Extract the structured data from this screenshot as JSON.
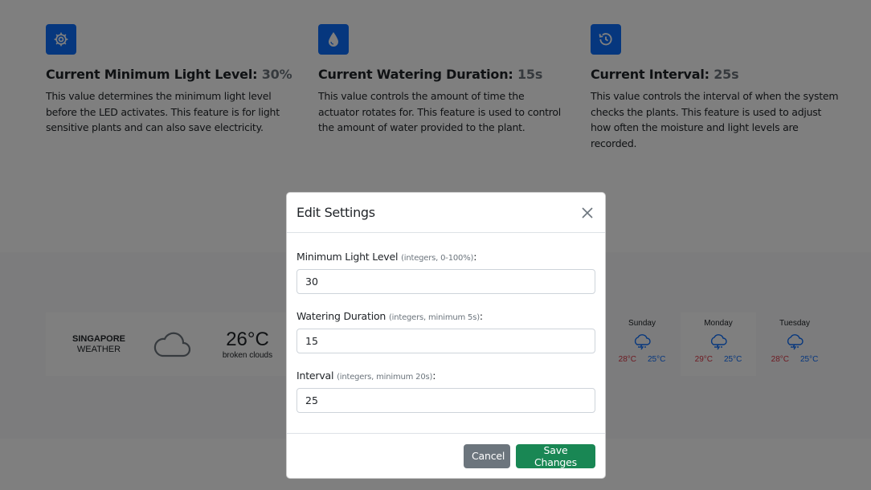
{
  "features": [
    {
      "icon": "gear-icon",
      "title": "Current Minimum Light Level:",
      "value": "30%",
      "description": "This value determines the minimum light level before the LED activates. This feature is for light sensitive plants and can also save electricity."
    },
    {
      "icon": "water-drop-icon",
      "title": "Current Watering Duration:",
      "value": "15s",
      "description": "This value controls the amount of time the actuator rotates for. This feature is used to control the amount of water provided to the plant."
    },
    {
      "icon": "history-clock-icon",
      "title": "Current Interval:",
      "value": "25s",
      "description": "This value controls the interval of when the system checks the plants. This feature is used to adjust how often the moisture and light levels are recorded."
    }
  ],
  "weather": {
    "city": "SINGAPORE",
    "city_sub": "WEATHER",
    "temp": "26°C",
    "condition": "broken clouds",
    "icon": "cloud-icon",
    "forecast": [
      {
        "day": "Sunday",
        "high": "28°C",
        "low": "25°C",
        "icon": "thunderstorm-icon"
      },
      {
        "day": "Monday",
        "high": "29°C",
        "low": "25°C",
        "icon": "thunderstorm-icon"
      },
      {
        "day": "Tuesday",
        "high": "28°C",
        "low": "25°C",
        "icon": "thunderstorm-icon"
      }
    ]
  },
  "modal": {
    "title": "Edit Settings",
    "fields": [
      {
        "label": "Minimum Light Level",
        "hint": "(integers, 0-100%)",
        "colon": ":",
        "value": "30"
      },
      {
        "label": "Watering Duration",
        "hint": "(integers, minimum 5s)",
        "colon": ":",
        "value": "15"
      },
      {
        "label": "Interval",
        "hint": "(integers, minimum 20s)",
        "colon": ":",
        "value": "25"
      }
    ],
    "cancel_label": "Cancel",
    "save_label": "Save Changes"
  },
  "colors": {
    "primary": "#0d6efd",
    "success": "#198754",
    "secondary": "#6c757d",
    "danger": "#dc3545"
  }
}
